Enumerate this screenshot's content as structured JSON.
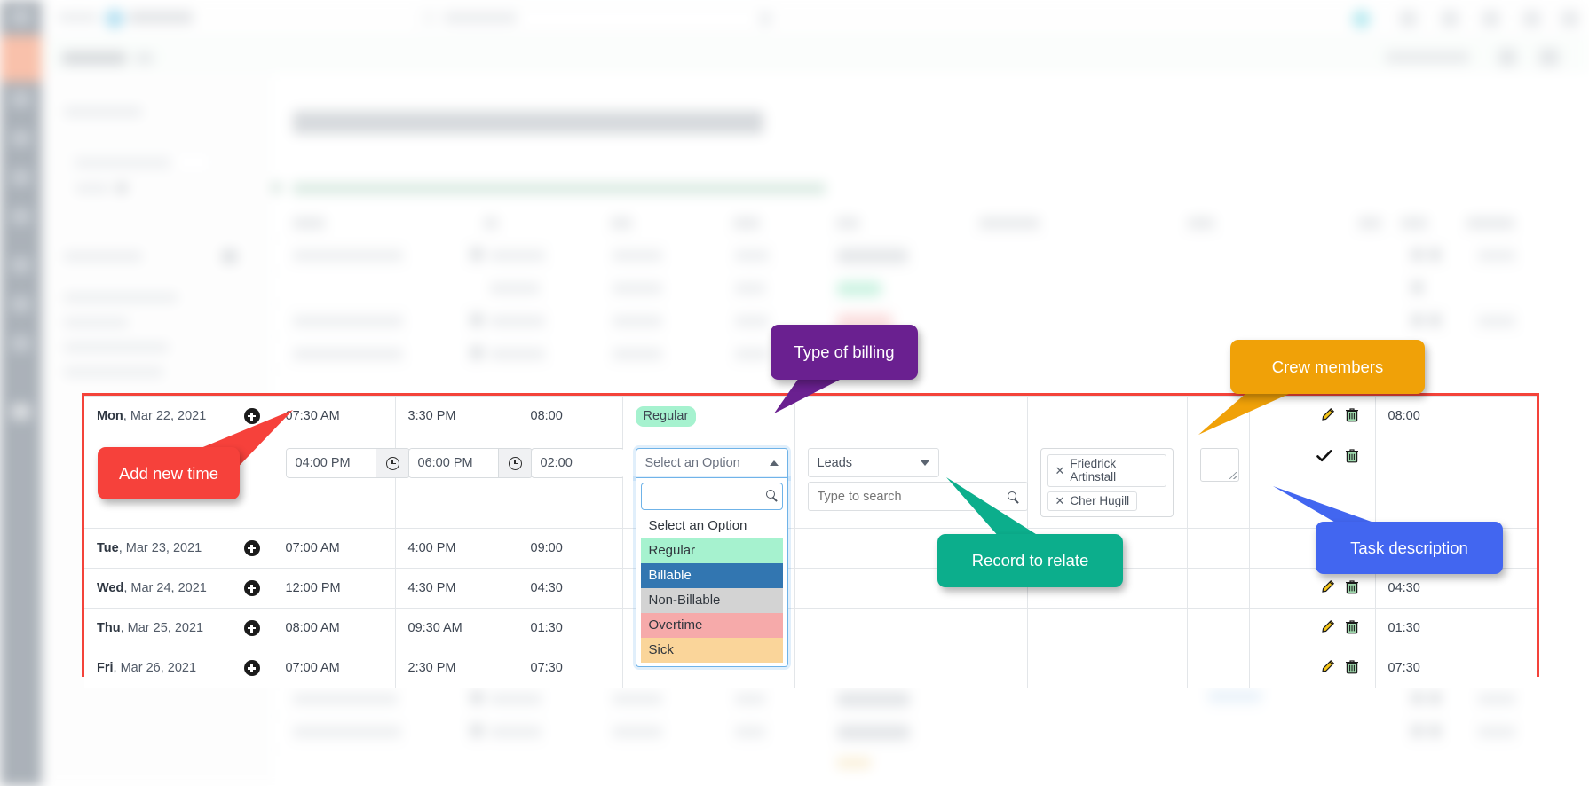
{
  "app": {
    "accent_red": "#f4433a",
    "brand_orange": "#f0642d",
    "rail_dark": "#2d3e50"
  },
  "background": {
    "search_placeholder": "Type to search"
  },
  "timesheet": {
    "columns": [
      "Date",
      "In",
      "Out",
      "Total",
      "Type",
      "Related To",
      "Crew",
      "Task",
      "Action",
      "Duration"
    ],
    "rows": [
      {
        "day": "Mon",
        "date": ", Mar 22, 2021",
        "time_in": "07:30 AM",
        "time_out": "3:30 PM",
        "total": "08:00",
        "type": "Regular",
        "type_color": "#a6f2cf",
        "duration": "08:00",
        "editing": false
      },
      {
        "day": "Tue",
        "date": ", Mar 23, 2021",
        "time_in": "07:00 AM",
        "time_out": "4:00 PM",
        "total": "09:00",
        "type": "",
        "duration": "",
        "editing": false
      },
      {
        "day": "Wed",
        "date": ", Mar 24, 2021",
        "time_in": "12:00 PM",
        "time_out": "4:30 PM",
        "total": "04:30",
        "type": "",
        "duration": "04:30",
        "editing": false
      },
      {
        "day": "Thu",
        "date": ", Mar 25, 2021",
        "time_in": "08:00 AM",
        "time_out": "09:30 AM",
        "total": "01:30",
        "type": "",
        "duration": "01:30",
        "editing": false
      },
      {
        "day": "Fri",
        "date": ", Mar 26, 2021",
        "time_in": "07:00 AM",
        "time_out": "2:30 PM",
        "total": "07:30",
        "type": "",
        "duration": "07:30",
        "editing": false
      }
    ],
    "edit_row": {
      "time_in_value": "04:00 PM",
      "time_out_value": "06:00 PM",
      "total_value": "02:00",
      "type_select_label": "Select an Option",
      "type_search_value": "",
      "type_options": [
        {
          "label": "Select an Option",
          "color": "#ffffff",
          "text_color": "#30363d"
        },
        {
          "label": "Regular",
          "color": "#a6f2cf",
          "text_color": "#30363d"
        },
        {
          "label": "Billable",
          "color": "#3276b1",
          "text_color": "#ffffff"
        },
        {
          "label": "Non-Billable",
          "color": "#d3d3d3",
          "text_color": "#30363d"
        },
        {
          "label": "Overtime",
          "color": "#f6aaaa",
          "text_color": "#30363d"
        },
        {
          "label": "Sick",
          "color": "#fad59a",
          "text_color": "#30363d"
        }
      ],
      "related_module": "Leads",
      "related_search_placeholder": "Type to search",
      "crew_members": [
        "Friedrick Artinstall",
        "Cher Hugill"
      ],
      "task_description": ""
    }
  },
  "callouts": [
    {
      "id": "add-new-time",
      "label": "Add new time",
      "color": "#f6413b"
    },
    {
      "id": "type-billing",
      "label": "Type of billing",
      "color": "#6a2090"
    },
    {
      "id": "crew-members",
      "label": "Crew members",
      "color": "#f0a108"
    },
    {
      "id": "record-relate",
      "label": "Record to relate",
      "color": "#0cae8c"
    },
    {
      "id": "task-desc",
      "label": "Task description",
      "color": "#4266f0"
    }
  ]
}
